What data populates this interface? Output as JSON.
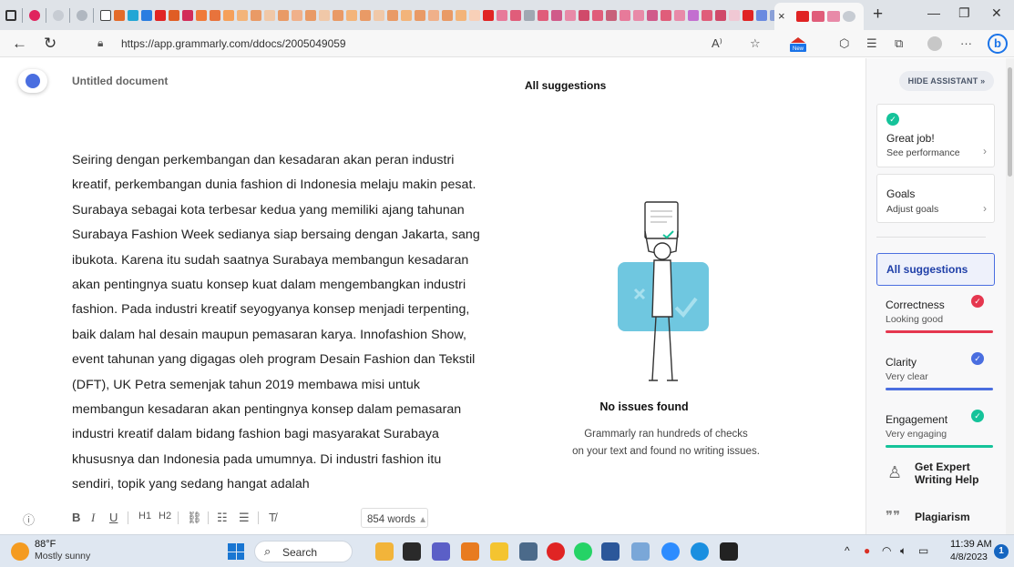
{
  "browser": {
    "active_tab_close": "×",
    "new_tab": "+",
    "url": "https://app.grammarly.com/ddocs/2005049059",
    "new_badge": "New",
    "bing_label": "b",
    "more": "···"
  },
  "header": {
    "doc_title": "Untitled document",
    "suggestions_heading": "All suggestions"
  },
  "document": {
    "paragraph": "Seiring dengan perkembangan dan kesadaran akan peran industri kreatif, perkembangan dunia fashion di Indonesia melaju makin pesat. Surabaya sebagai kota terbesar kedua yang memiliki ajang tahunan Surabaya Fashion Week sedianya siap bersaing dengan Jakarta, sang ibukota. Karena itu sudah saatnya Surabaya membangun kesadaran akan pentingnya suatu konsep kuat dalam mengembangkan industri fashion. Pada industri kreatif seyogyanya konsep menjadi terpenting, baik dalam hal desain maupun pemasaran karya. Innofashion Show, event tahunan yang digagas oleh program Desain Fashion dan Tekstil (DFT), UK Petra semenjak tahun 2019 membawa misi untuk membangun kesadaran akan pentingnya konsep dalam pemasaran industri kreatif dalam bidang fashion bagi masyarakat Surabaya khususnya dan Indonesia pada umumnya. Di industri fashion itu sendiri, topik yang sedang hangat adalah"
  },
  "toolbar": {
    "bold": "B",
    "italic": "I",
    "underline": "U",
    "h1": "H1",
    "h2": "H2",
    "word_count": "854 words",
    "word_count_arrow": "▴"
  },
  "empty_state": {
    "title": "No issues found",
    "desc_line1": "Grammarly ran hundreds of checks",
    "desc_line2": "on your text and found no writing issues."
  },
  "sidebar": {
    "hide_assistant": "HIDE ASSISTANT »",
    "great_job": {
      "title": "Great job!",
      "sub": "See performance"
    },
    "goals": {
      "title": "Goals",
      "sub": "Adjust goals"
    },
    "all_suggestions": "All suggestions",
    "categories": [
      {
        "name": "Correctness",
        "status": "Looking good",
        "color": "#e5374f"
      },
      {
        "name": "Clarity",
        "status": "Very clear",
        "color": "#4a6ee0"
      },
      {
        "name": "Engagement",
        "status": "Very engaging",
        "color": "#15c39a"
      }
    ],
    "expert_line1": "Get Expert",
    "expert_line2": "Writing Help",
    "plagiarism": "Plagiarism"
  },
  "taskbar": {
    "temp": "88°F",
    "weather": "Mostly sunny",
    "search": "Search",
    "time": "11:39 AM",
    "date": "4/8/2023",
    "notifications": "1"
  }
}
